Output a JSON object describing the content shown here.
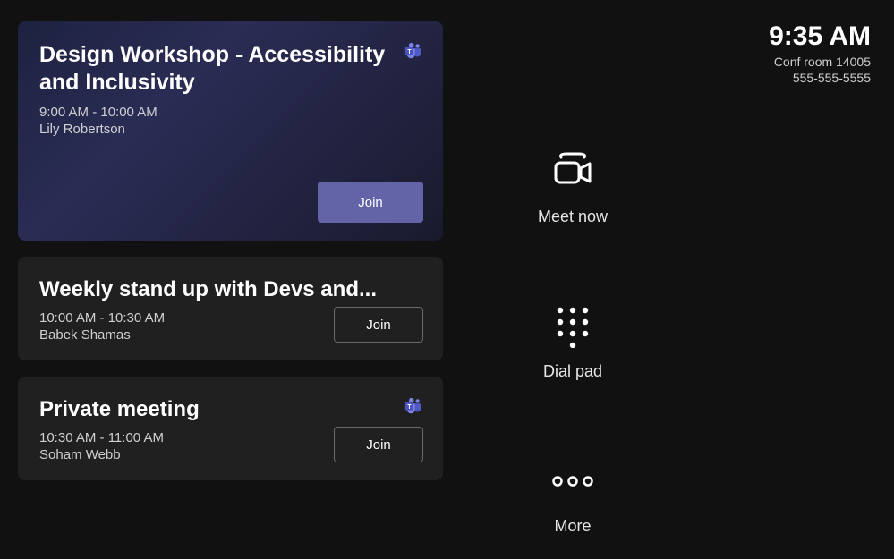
{
  "room": {
    "clock": "9:35 AM",
    "name": "Conf room 14005",
    "phone": "555-555-5555"
  },
  "meetings": [
    {
      "title": "Design Workshop - Accessibility and Inclusivity",
      "time": "9:00 AM - 10:00 AM",
      "organizer": "Lily Robertson",
      "join_label": "Join"
    },
    {
      "title": "Weekly stand up with Devs and...",
      "time": "10:00 AM - 10:30 AM",
      "organizer": "Babek Shamas",
      "join_label": "Join"
    },
    {
      "title": "Private meeting",
      "time": "10:30 AM - 11:00 AM",
      "organizer": "Soham Webb",
      "join_label": "Join"
    }
  ],
  "actions": {
    "meet_now": "Meet now",
    "dial_pad": "Dial pad",
    "more": "More"
  }
}
